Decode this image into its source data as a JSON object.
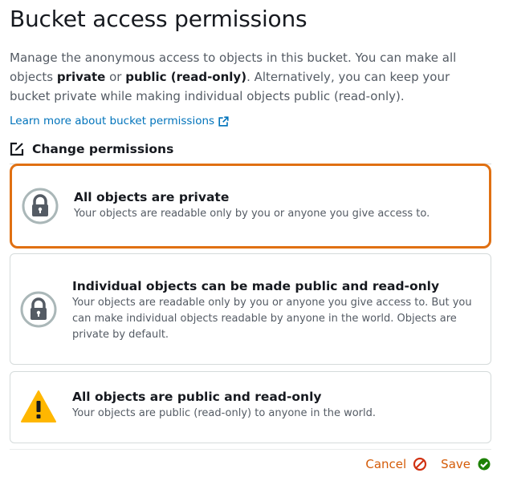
{
  "page": {
    "title": "Bucket access permissions",
    "description": {
      "part1": "Manage the anonymous access to objects in this bucket. You can make all objects ",
      "private_bold": "private",
      "part2": " or ",
      "public_bold": "public (read-only)",
      "part3": ". Alternatively, you can keep your bucket private while making individual objects public (read-only)."
    },
    "learn_more": "Learn more about bucket permissions",
    "change_permissions": "Change permissions"
  },
  "options": [
    {
      "title": "All objects are private",
      "text": "Your objects are readable only by you or anyone you give access to.",
      "icon": "lock-icon",
      "selected": true
    },
    {
      "title": "Individual objects can be made public and read-only",
      "text": "Your objects are readable only by you or anyone you give access to. But you can make individual objects readable by anyone in the world. Objects are private by default.",
      "icon": "lock-icon",
      "selected": false
    },
    {
      "title": "All objects are public and read-only",
      "text": "Your objects are public (read-only) to anyone in the world.",
      "icon": "warning-icon",
      "selected": false
    }
  ],
  "actions": {
    "cancel": "Cancel",
    "save": "Save"
  },
  "colors": {
    "accent": "#e07012",
    "link": "#0073bb",
    "action": "#d45b07",
    "cancel_icon": "#d13212",
    "save_icon": "#1d8102",
    "warning": "#ffb700"
  }
}
